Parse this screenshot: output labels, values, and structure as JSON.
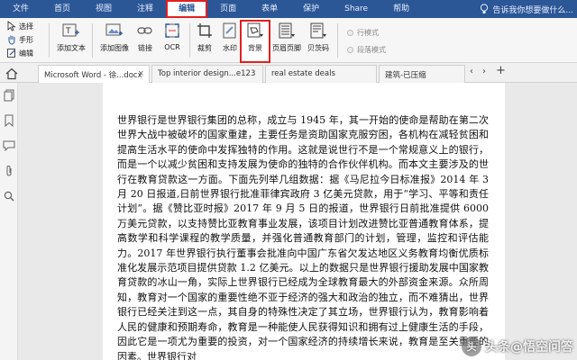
{
  "menu": {
    "items": [
      "文件",
      "首页",
      "视图",
      "注释",
      "编辑",
      "页面",
      "表单",
      "保护",
      "Share",
      "帮助"
    ],
    "active_index": 4,
    "tell_me": "告诉我你想要做什么..."
  },
  "toolbar": {
    "select_label": "选择",
    "hand_label": "手形",
    "edit_label": "编辑",
    "buttons": [
      "添加文本",
      "添加图像",
      "链接",
      "OCR",
      "裁剪",
      "水印",
      "背景",
      "页眉页脚",
      "贝茨码"
    ],
    "highlighted": "背景",
    "line_mode": "行模式",
    "paragraph_mode": "段落模式"
  },
  "tabs": [
    {
      "label": "Microsoft Word - 徐...docx",
      "active": true
    },
    {
      "label": "Top interior design...e123",
      "active": false
    },
    {
      "label": "real estate deals",
      "active": false
    },
    {
      "label": "建筑-已压缩",
      "active": false
    }
  ],
  "tab_add": "+",
  "document": {
    "text": "世界银行是世界银行集团的总称，成立与 1945 年，其一开始的使命是帮助在第二次世界大战中被破坏的国家重建，主要任务是资助国家克服穷困，各机构在减轻贫困和提高生活水平的使命中发挥独特的作用。这就是说世行不是一个常规意义上的银行，而是一个以减少贫困和支持发展为使命的独特的合作伙伴机构。而本文主要涉及的世行在教育贷款这一方面。下面先列举几组数据：据《马尼拉今日标准报》2014 年 3 月 20 日报道,日前世界银行批准菲律宾政府 3 亿美元贷款，用于“学习、平等和责任计划”。据《赞比亚时报》2017 年 9 月 5 日的报道，世界银行日前批准提供 6000 万美元贷款，以支持赞比亚教育事业发展，该项目计划改进赞比亚普通教育体系，提高数学和科学课程的教学质量，并强化普通教育部门的计划，管理，监控和评估能力。2017 年世界银行执行董事会批准向中国广东省欠发达地区义务教育均衡优质标准化发展示范项目提供贷款 1.2 亿美元。以上的数据只是世界银行援助发展中国家教育贷款的冰山一角，实际上世界银行已经成为全球教育最大的外部资金来源。众所周知，教育对一个国家的重要性绝不亚于经济的强大和政治的独立，而不难猜出，世界银行已经关注到这一点，其自身的特殊性决定了其立场，世界银行认为，教育影响着人民的健康和预期寿命，教育是一种能使人民获得知识和拥有过上健康生活的手段，因此它是一项尤为重要的投资，对一个国家经济的持续增长来说，教育是至关重要的因素。世界银行对"
  },
  "watermark": {
    "text": "头条@悟空问答",
    "logo": "头"
  }
}
